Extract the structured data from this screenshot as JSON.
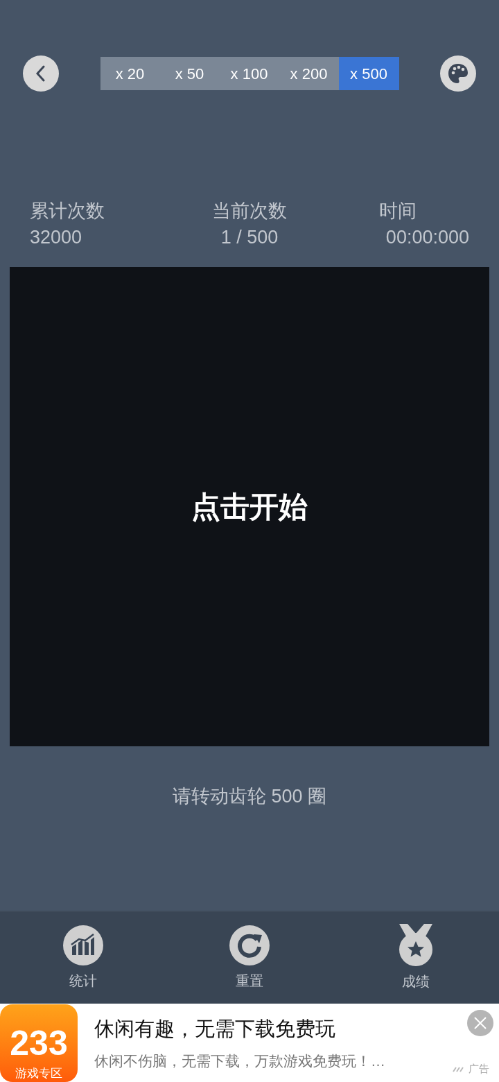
{
  "multipliers": [
    {
      "label": "x 20",
      "selected": false
    },
    {
      "label": "x 50",
      "selected": false
    },
    {
      "label": "x 100",
      "selected": false
    },
    {
      "label": "x 200",
      "selected": false
    },
    {
      "label": "x 500",
      "selected": true
    }
  ],
  "stats": [
    {
      "label": "累计次数",
      "value": "32000"
    },
    {
      "label": "当前次数",
      "value": "1 / 500"
    },
    {
      "label": "时间",
      "value": "00:00:000"
    }
  ],
  "board": {
    "prompt": "点击开始"
  },
  "hint": "请转动齿轮 500 圈",
  "bottom_nav": [
    {
      "kind": "stats",
      "label": "统计"
    },
    {
      "kind": "reset",
      "label": "重置"
    },
    {
      "kind": "medal",
      "label": "成绩"
    }
  ],
  "ad": {
    "logo_number": "233",
    "logo_caption": "游戏专区",
    "title": "休闲有趣，无需下载免费玩",
    "subtitle": "休闲不伤脑，无需下载，万款游戏免费玩！…",
    "ad_label": "广告"
  }
}
